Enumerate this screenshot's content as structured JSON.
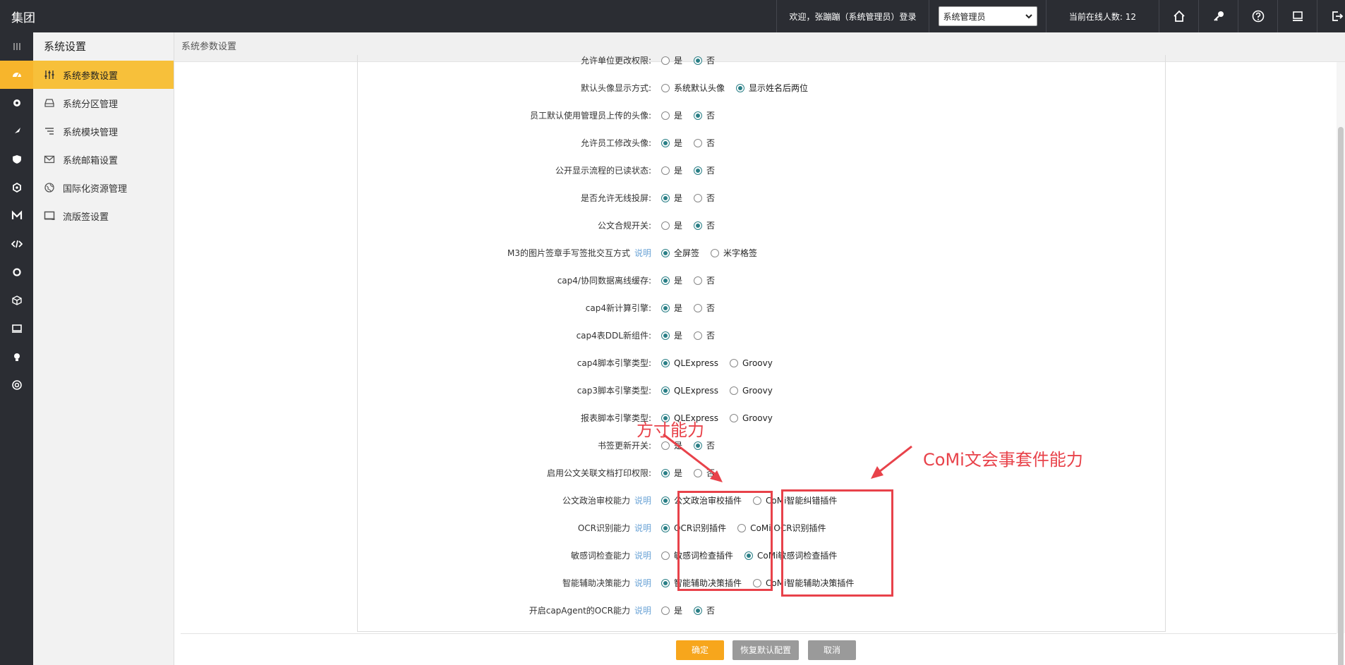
{
  "header": {
    "brand": "集团",
    "welcome": "欢迎，张蹦蹦（系统管理员）登录",
    "role_selected": "系统管理员",
    "online": "当前在线人数: 12",
    "icons": [
      "home-icon",
      "key-icon",
      "help-icon",
      "monitor-icon",
      "logout-icon"
    ]
  },
  "rail": {
    "icons": [
      "menu-icon",
      "dashboard-icon",
      "gear-icon",
      "pin-icon",
      "shield-icon",
      "hexagon-icon",
      "m-icon",
      "code-icon",
      "settings-icon",
      "cube-icon",
      "screen-icon",
      "lightbulb-icon",
      "at-icon"
    ]
  },
  "sidebar": {
    "title": "系统设置",
    "items": [
      {
        "label": "系统参数设置",
        "icon": "sliders-icon",
        "active": true
      },
      {
        "label": "系统分区管理",
        "icon": "partition-icon",
        "active": false
      },
      {
        "label": "系统模块管理",
        "icon": "list-icon",
        "active": false
      },
      {
        "label": "系统邮箱设置",
        "icon": "mail-icon",
        "active": false
      },
      {
        "label": "国际化资源管理",
        "icon": "globe-icon",
        "active": false
      },
      {
        "label": "流版签设置",
        "icon": "frame-icon",
        "active": false
      }
    ]
  },
  "breadcrumb": "系统参数设置",
  "form": {
    "explain_label": "说明",
    "rows": [
      {
        "label": "允许单位更改权限:",
        "options": [
          "是",
          "否"
        ],
        "selected": 1,
        "explain": false
      },
      {
        "label": "默认头像显示方式:",
        "options": [
          "系统默认头像",
          "显示姓名后两位"
        ],
        "selected": 1,
        "explain": false
      },
      {
        "label": "员工默认使用管理员上传的头像:",
        "options": [
          "是",
          "否"
        ],
        "selected": 1,
        "explain": false
      },
      {
        "label": "允许员工修改头像:",
        "options": [
          "是",
          "否"
        ],
        "selected": 0,
        "explain": false
      },
      {
        "label": "公开显示流程的已读状态:",
        "options": [
          "是",
          "否"
        ],
        "selected": 1,
        "explain": false
      },
      {
        "label": "是否允许无线投屏:",
        "options": [
          "是",
          "否"
        ],
        "selected": 0,
        "explain": false
      },
      {
        "label": "公文合规开关:",
        "options": [
          "是",
          "否"
        ],
        "selected": 1,
        "explain": false
      },
      {
        "label": "M3的图片签章手写签批交互方式",
        "options": [
          "全屏签",
          "米字格签"
        ],
        "selected": 0,
        "explain": true
      },
      {
        "label": "cap4/协同数据离线缓存:",
        "options": [
          "是",
          "否"
        ],
        "selected": 0,
        "explain": false
      },
      {
        "label": "cap4新计算引擎:",
        "options": [
          "是",
          "否"
        ],
        "selected": 0,
        "explain": false
      },
      {
        "label": "cap4表DDL新组件:",
        "options": [
          "是",
          "否"
        ],
        "selected": 0,
        "explain": false
      },
      {
        "label": "cap4脚本引擎类型:",
        "options": [
          "QLExpress",
          "Groovy"
        ],
        "selected": 0,
        "explain": false
      },
      {
        "label": "cap3脚本引擎类型:",
        "options": [
          "QLExpress",
          "Groovy"
        ],
        "selected": 0,
        "explain": false
      },
      {
        "label": "报表脚本引擎类型:",
        "options": [
          "QLExpress",
          "Groovy"
        ],
        "selected": 0,
        "explain": false
      },
      {
        "label": "书签更新开关:",
        "options": [
          "是",
          "否"
        ],
        "selected": 1,
        "explain": false
      },
      {
        "label": "启用公文关联文档打印权限:",
        "options": [
          "是",
          "否"
        ],
        "selected": 0,
        "explain": false
      },
      {
        "label": "公文政治审校能力",
        "options": [
          "公文政治审校插件",
          "CoMi智能纠错插件"
        ],
        "selected": 0,
        "explain": true
      },
      {
        "label": "OCR识别能力",
        "options": [
          "OCR识别插件",
          "CoMi OCR识别插件"
        ],
        "selected": 0,
        "explain": true
      },
      {
        "label": "敏感词检查能力",
        "options": [
          "敏感词检查插件",
          "CoMi敏感词检查插件"
        ],
        "selected": 1,
        "explain": true
      },
      {
        "label": "智能辅助决策能力",
        "options": [
          "智能辅助决策插件",
          "CoMi智能辅助决策插件"
        ],
        "selected": 0,
        "explain": true
      },
      {
        "label": "开启capAgent的OCR能力",
        "options": [
          "是",
          "否"
        ],
        "selected": 1,
        "explain": true
      }
    ]
  },
  "footer": {
    "confirm": "确定",
    "restore": "恢复默认配置",
    "cancel": "取消"
  },
  "annotations": {
    "left_text": "方寸能力",
    "right_text": "CoMi文会事套件能力",
    "color": "#e8424a"
  },
  "colors": {
    "accent": "#f7b52c",
    "topbar": "#2b2d33",
    "radio": "#2a7f86",
    "explain": "#6aa3d6"
  }
}
